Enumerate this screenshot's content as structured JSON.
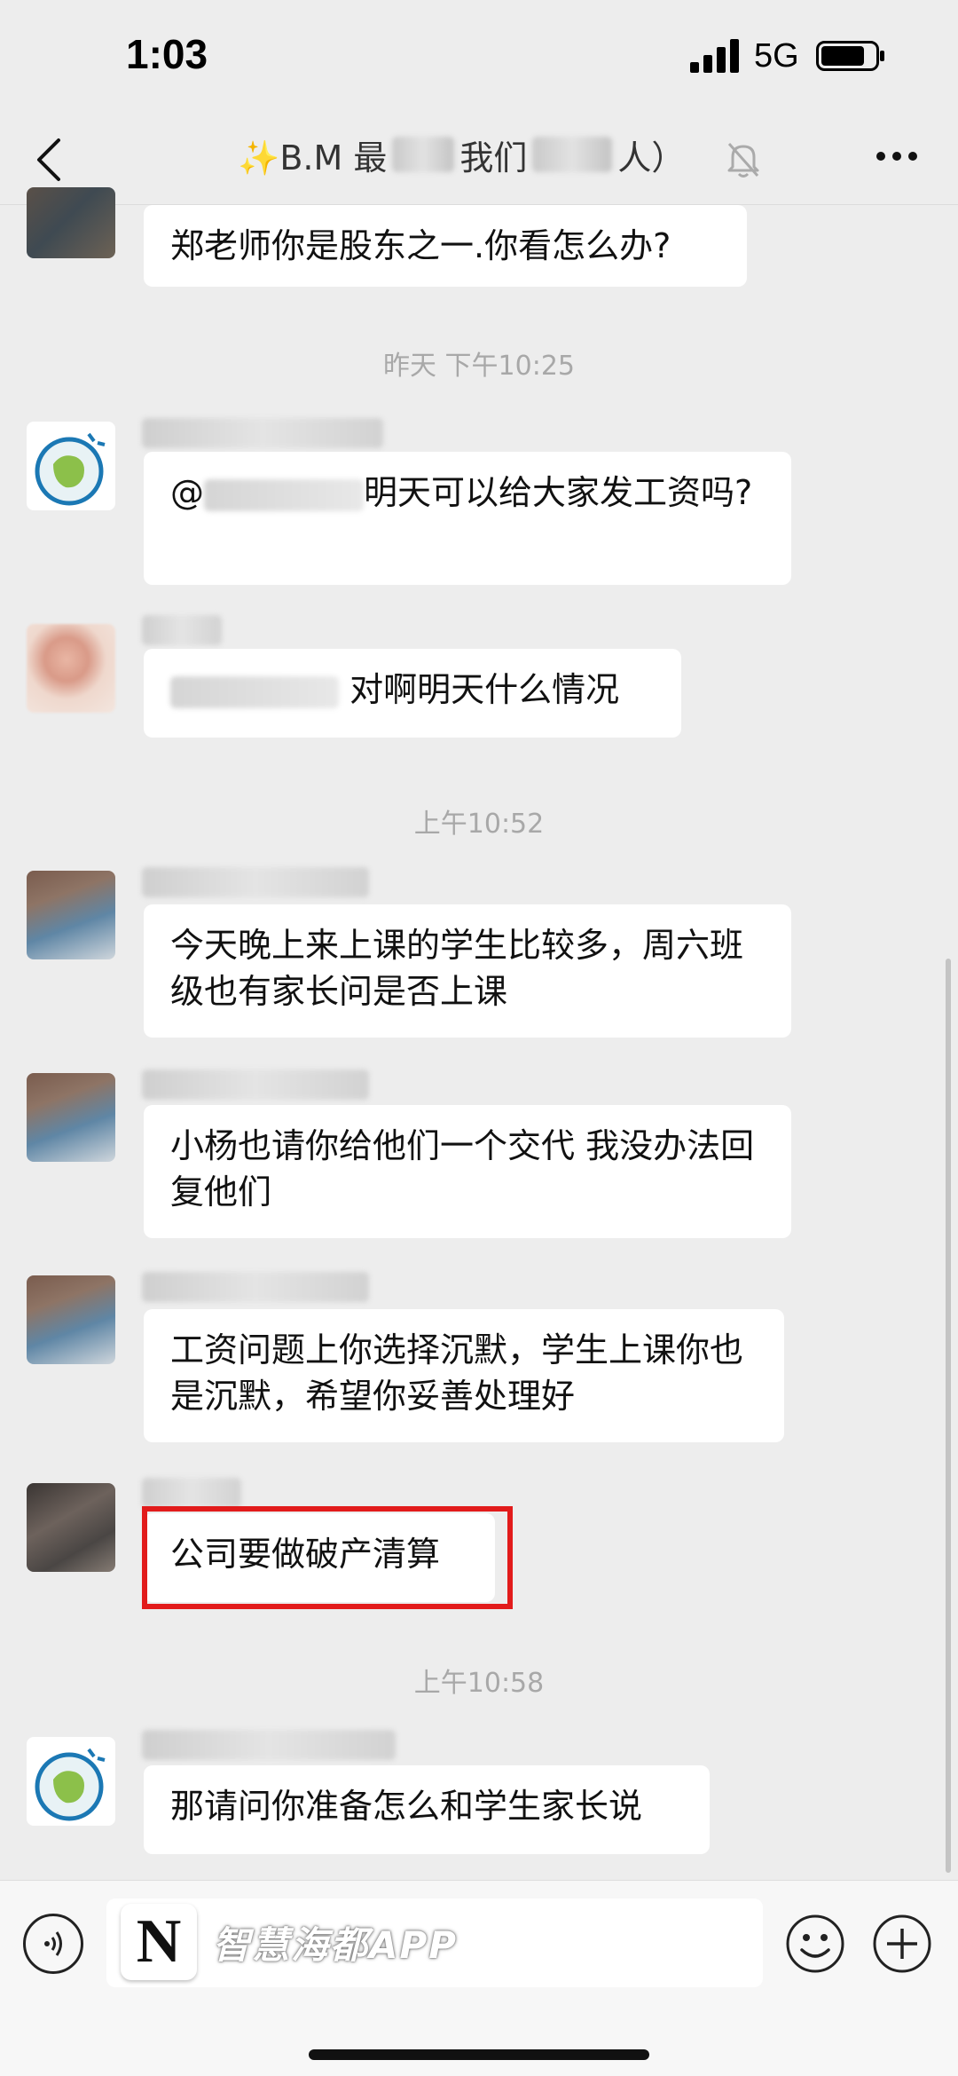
{
  "status_bar": {
    "time": "1:03",
    "network": "5G"
  },
  "nav": {
    "title_prefix": "✨B.M 最",
    "title_mid": "我们",
    "title_suffix": "人）"
  },
  "messages": [
    {
      "type": "text",
      "text": "郑老师你是股东之一.你看怎么办?"
    },
    {
      "type": "time",
      "text": "昨天 下午10:25"
    },
    {
      "type": "text",
      "text_prefix": "@",
      "text": "明天可以给大家发工资吗?"
    },
    {
      "type": "text",
      "text": "对啊明天什么情况"
    },
    {
      "type": "time",
      "text": "上午10:52"
    },
    {
      "type": "text",
      "text": "今天晚上来上课的学生比较多，周六班级也有家长问是否上课"
    },
    {
      "type": "text",
      "text": "小杨也请你给他们一个交代 我没办法回复他们"
    },
    {
      "type": "text",
      "text": "工资问题上你选择沉默，学生上课你也是沉默，希望你妥善处理好"
    },
    {
      "type": "text",
      "text": "公司要做破产清算",
      "highlighted": true
    },
    {
      "type": "time",
      "text": "上午10:58"
    },
    {
      "type": "text",
      "text": "那请问你准备怎么和学生家长说"
    }
  ],
  "watermark": {
    "logo_letter": "N",
    "text": "智慧海都APP"
  },
  "colors": {
    "background": "#ededed",
    "bubble": "#ffffff",
    "highlight_border": "#e21b1b"
  }
}
